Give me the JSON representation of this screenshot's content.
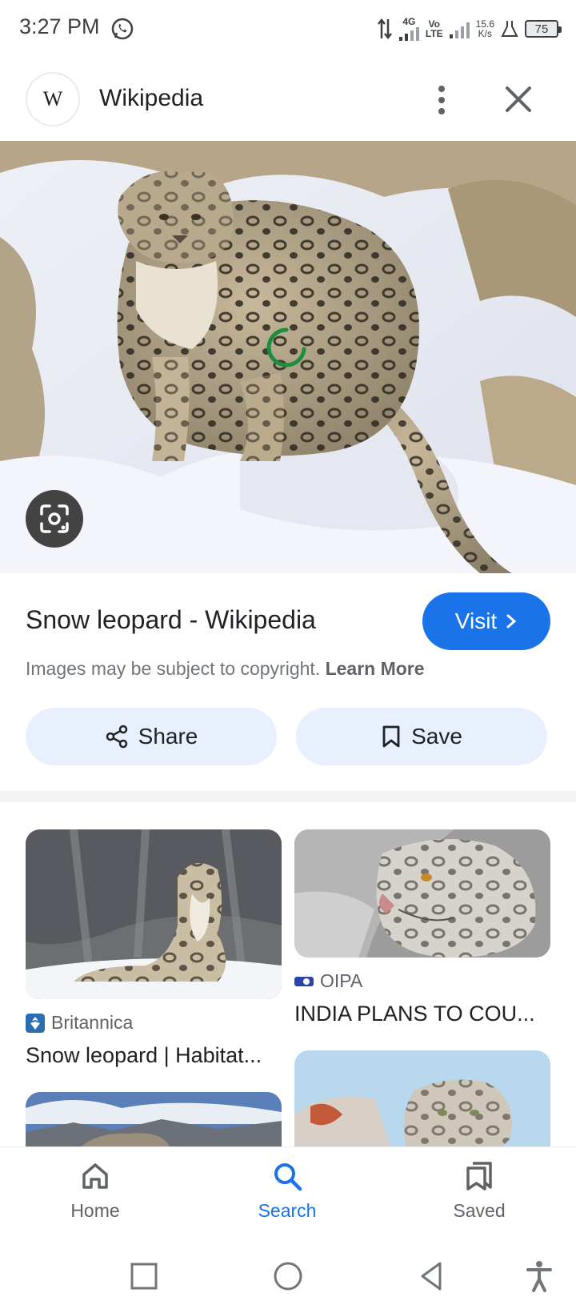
{
  "status_bar": {
    "time": "3:27 PM",
    "network_1": "4G",
    "network_2_top": "Vo",
    "network_2_bottom": "LTE",
    "speed_top": "15.6",
    "speed_bottom": "K/s",
    "battery": "75"
  },
  "header": {
    "logo_text": "W",
    "title": "Wikipedia"
  },
  "result": {
    "title": "Snow leopard - Wikipedia",
    "visit_label": "Visit",
    "copyright_text": "Images may be subject to copyright.",
    "learn_more": "Learn More",
    "share_label": "Share",
    "save_label": "Save"
  },
  "related": [
    {
      "source": "Britannica",
      "caption": "Snow leopard | Habitat..."
    },
    {
      "source": "OIPA",
      "caption": "INDIA PLANS TO COU..."
    }
  ],
  "bottom_nav": [
    {
      "label": "Home",
      "icon": "home-icon",
      "active": false
    },
    {
      "label": "Search",
      "icon": "search-icon",
      "active": true
    },
    {
      "label": "Saved",
      "icon": "saved-icon",
      "active": false
    }
  ],
  "colors": {
    "accent": "#1a73e8",
    "pill_bg": "#e8f0fe",
    "spinner": "#1e8e3e"
  }
}
